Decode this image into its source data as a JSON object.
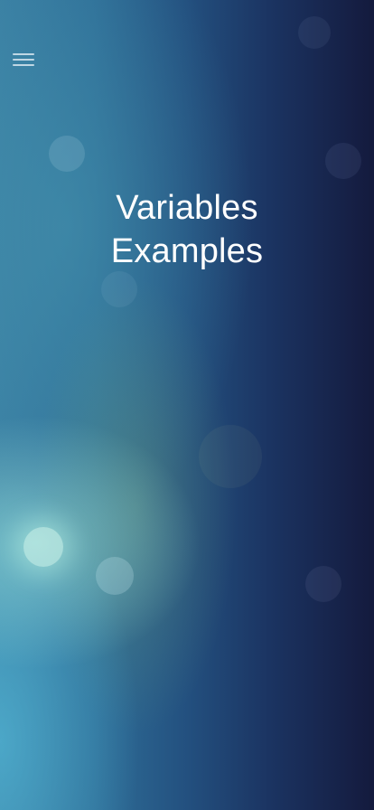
{
  "header": {
    "menu_icon": "hamburger-menu-icon"
  },
  "hero": {
    "title_line_1": "Variables",
    "title_line_2": "Examples"
  },
  "colors": {
    "background_left": "#3a7fa3",
    "background_right": "#141a3d",
    "title_text": "#ffffff",
    "menu_icon": "#d7e6f0"
  }
}
